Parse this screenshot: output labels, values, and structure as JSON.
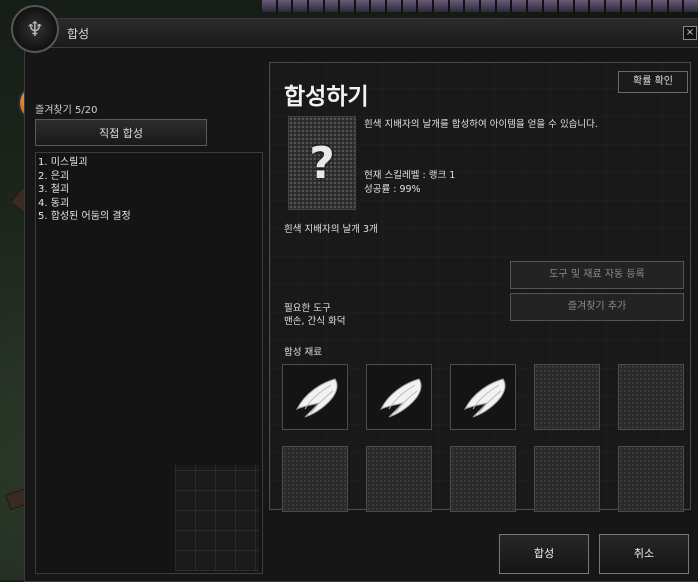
{
  "window": {
    "title": "합성",
    "close_label": "×"
  },
  "left_panel": {
    "favorites_count": "즐겨찾기 5/20",
    "direct_synthesis_label": "직접 합성",
    "recipes": [
      "1. 미스릴괴",
      "2. 은괴",
      "3. 철괴",
      "4. 동괴",
      "5. 합성된 어둠의 결정"
    ]
  },
  "right_panel": {
    "title": "합성하기",
    "guide_button": "확률 확인",
    "item_image_glyph": "?",
    "description": "흰색 지배자의 날개를 합성하여 아이템을 얻을 수 있습니다.",
    "skill_level": "현재 스킬레벨 : 랭크 1",
    "success_rate": "성공률 : 99%",
    "item_name_count": "흰색 지배자의 날개 3개",
    "auto_register_button": "도구 및 재료 자동 등록",
    "add_favorite_button": "즐겨찾기 추가",
    "required_tool_label": "필요한 도구",
    "required_tool_value": "맨손, 간식 화덕",
    "materials_label": "합성 재료",
    "material_slots": [
      "white-wing-icon",
      "white-wing-icon",
      "white-wing-icon",
      "empty",
      "empty",
      "empty",
      "empty",
      "empty",
      "empty",
      "empty"
    ]
  },
  "buttons": {
    "synthesize": "합성",
    "cancel": "취소"
  }
}
